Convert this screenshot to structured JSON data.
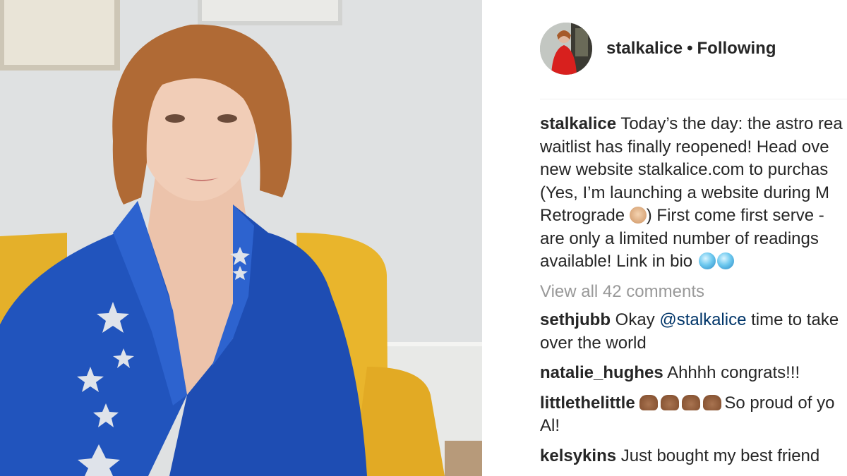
{
  "post": {
    "username": "stalkalice",
    "separator": "•",
    "follow_status": "Following",
    "caption_username": "stalkalice",
    "caption_lines": [
      "Today’s the day: the astro rea",
      "waitlist has finally reopened! Head ove",
      "new website stalkalice.com to purchas",
      "(Yes, I’m launching a website during M",
      "Retrograde",
      ") First come first serve -",
      "are only a limited number of readings",
      "available! Link in bio"
    ],
    "view_all_comments": "View all 42 comments",
    "comments": [
      {
        "user": "sethjubb",
        "text_before": "Okay",
        "mention": "@stalkalice",
        "text_after": "time to take",
        "line2": "over the world"
      },
      {
        "user": "natalie_hughes",
        "text": "Ahhhh congrats!!!"
      },
      {
        "user": "littlethelittle",
        "text": "So proud of yo",
        "line2": "Al!"
      },
      {
        "user": "kelsykins",
        "text": "Just bought my best friend"
      }
    ]
  },
  "icons": {
    "caption_emoji_1": "woman-facepalming-emoji",
    "caption_emoji_2": "crystal-ball-emoji",
    "comment_emoji": "raising-hands-emoji"
  },
  "colors": {
    "text": "#262626",
    "muted": "#999999",
    "mention": "#003569",
    "jacket": "#1f4fb8",
    "chair": "#e6b42a"
  }
}
